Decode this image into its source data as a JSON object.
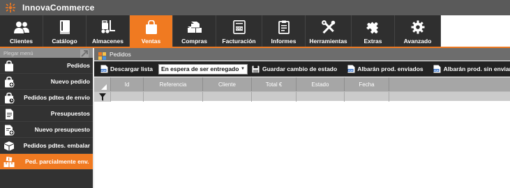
{
  "app": {
    "title": "InnovaCommerce"
  },
  "modules": [
    {
      "label": "Clientes",
      "icon": "users-icon"
    },
    {
      "label": "Catálogo",
      "icon": "book-icon"
    },
    {
      "label": "Almacenes",
      "icon": "forklift-icon"
    },
    {
      "label": "Ventas",
      "icon": "shopping-bag-icon",
      "active": true
    },
    {
      "label": "Compras",
      "icon": "boxes-icon"
    },
    {
      "label": "Facturación",
      "icon": "invoice-icon"
    },
    {
      "label": "Informes",
      "icon": "report-icon"
    },
    {
      "label": "Herramientas",
      "icon": "tools-icon"
    },
    {
      "label": "Extras",
      "icon": "puzzle-icon"
    },
    {
      "label": "Avanzado",
      "icon": "gear-icon"
    }
  ],
  "sidebar": {
    "search_placeholder": "Plegar menú",
    "items": [
      {
        "label": "Pedidos",
        "icon": "bag-icon"
      },
      {
        "label": "Nuevo pedido",
        "icon": "bag-plus-icon"
      },
      {
        "label": "Pedidos pdtes de envio",
        "icon": "bag-clock-icon"
      },
      {
        "label": "Presupuestos",
        "icon": "document-icon"
      },
      {
        "label": "Nuevo presupuesto",
        "icon": "document-plus-icon"
      },
      {
        "label": "Pedidos pdtes. embalar",
        "icon": "box-icon"
      },
      {
        "label": "Ped. parcialmente env.",
        "icon": "boxes-icon",
        "active": true
      }
    ]
  },
  "main": {
    "tab": {
      "label": "Pedidos"
    },
    "actions": {
      "download_list": "Descargar lista",
      "status_select": "En espera de ser entregado",
      "save_status": "Guardar cambio de estado",
      "delivery_sent": "Albarán prod. enviados",
      "delivery_unsent": "Albarán prod. sin enviar"
    },
    "grid": {
      "columns": [
        "Id",
        "Referencia",
        "Cliente",
        "Total €",
        "Estado",
        "Fecha"
      ]
    }
  },
  "colors": {
    "accent": "#f07a21",
    "toolbar": "#2f2f2f",
    "titlebar": "#5a5a5a",
    "sidebar": "#323232"
  }
}
